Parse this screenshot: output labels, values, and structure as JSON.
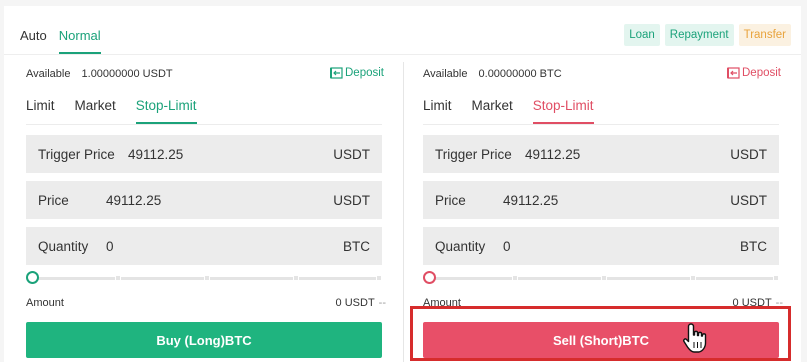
{
  "mode_tabs": [
    "Auto",
    "Normal"
  ],
  "chips": {
    "loan": "Loan",
    "repayment": "Repayment",
    "transfer": "Transfer"
  },
  "colors": {
    "green": "#1ba27a",
    "red": "#e04e64",
    "buy_button": "#1fb47f",
    "sell_button": "#e84f68",
    "highlight": "#d62c2c"
  },
  "buy": {
    "available_label": "Available",
    "available_value": "1.00000000 USDT",
    "deposit": "Deposit",
    "tabs": [
      "Limit",
      "Market",
      "Stop-Limit"
    ],
    "active_tab": "Stop-Limit",
    "trigger_label": "Trigger Price",
    "trigger_value": "49112.25",
    "trigger_unit": "USDT",
    "price_label": "Price",
    "price_value": "49112.25",
    "price_unit": "USDT",
    "quantity_label": "Quantity",
    "quantity_value": "0",
    "quantity_unit": "BTC",
    "slider_percent": 0,
    "amount_label": "Amount",
    "amount_value": "0 USDT",
    "amount_dash": "--",
    "button": "Buy (Long)BTC"
  },
  "sell": {
    "available_label": "Available",
    "available_value": "0.00000000 BTC",
    "deposit": "Deposit",
    "tabs": [
      "Limit",
      "Market",
      "Stop-Limit"
    ],
    "active_tab": "Stop-Limit",
    "trigger_label": "Trigger Price",
    "trigger_value": "49112.25",
    "trigger_unit": "USDT",
    "price_label": "Price",
    "price_value": "49112.25",
    "price_unit": "USDT",
    "quantity_label": "Quantity",
    "quantity_value": "0",
    "quantity_unit": "BTC",
    "slider_percent": 0,
    "amount_label": "Amount",
    "amount_value": "0 USDT",
    "amount_dash": "--",
    "button": "Sell (Short)BTC"
  }
}
